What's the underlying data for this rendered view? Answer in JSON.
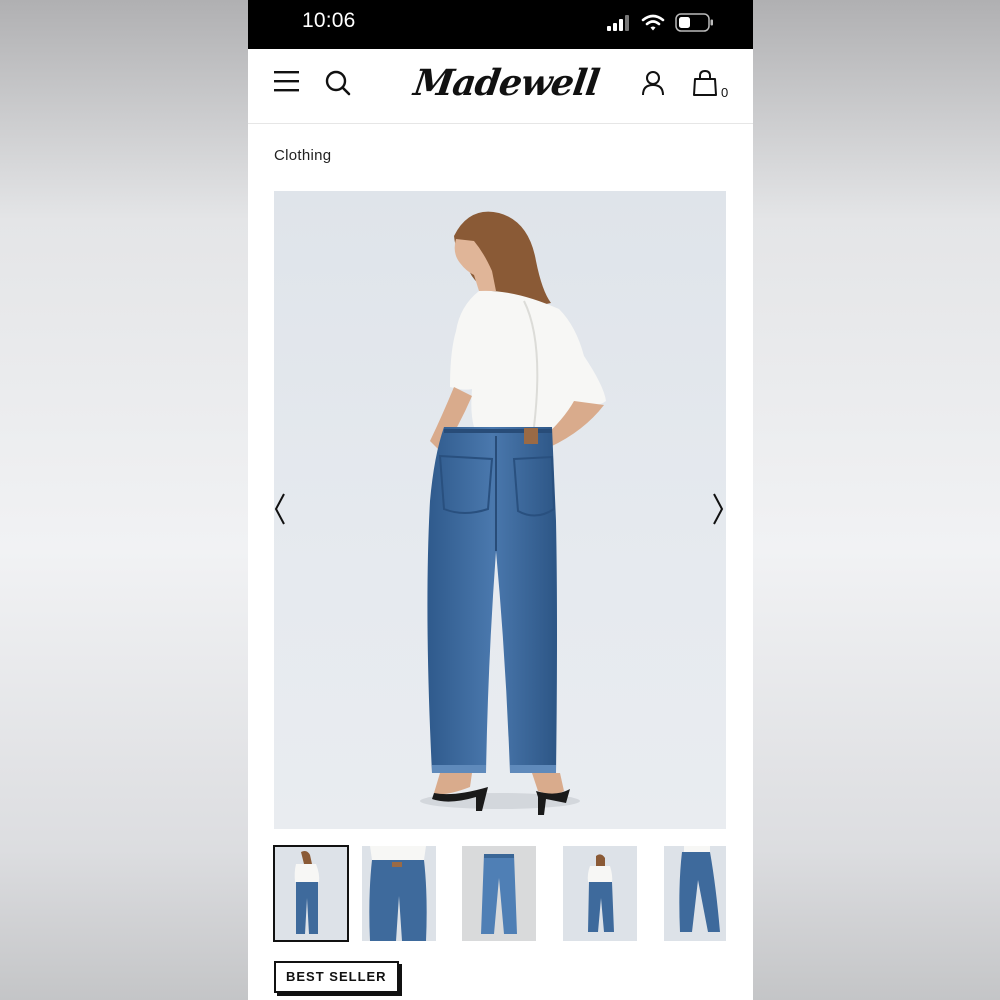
{
  "status_bar": {
    "time": "10:06",
    "icons": [
      "cellular-signal-icon",
      "wifi-icon",
      "battery-icon"
    ]
  },
  "header": {
    "brand": "Madewell",
    "menu_icon": "menu-icon",
    "search_icon": "search-icon",
    "account_icon": "account-icon",
    "bag_icon": "shopping-bag-icon",
    "bag_count": "0"
  },
  "breadcrumb": "Clothing",
  "gallery": {
    "prev_icon": "chevron-left-icon",
    "next_icon": "chevron-right-icon",
    "selected_index": 0,
    "thumbnail_count": 5
  },
  "badge": "BEST SELLER",
  "colors": {
    "status_bar": "#000000",
    "text": "#111111",
    "denim": "#3e6a9c",
    "photo_background": "#e3e7ec"
  }
}
